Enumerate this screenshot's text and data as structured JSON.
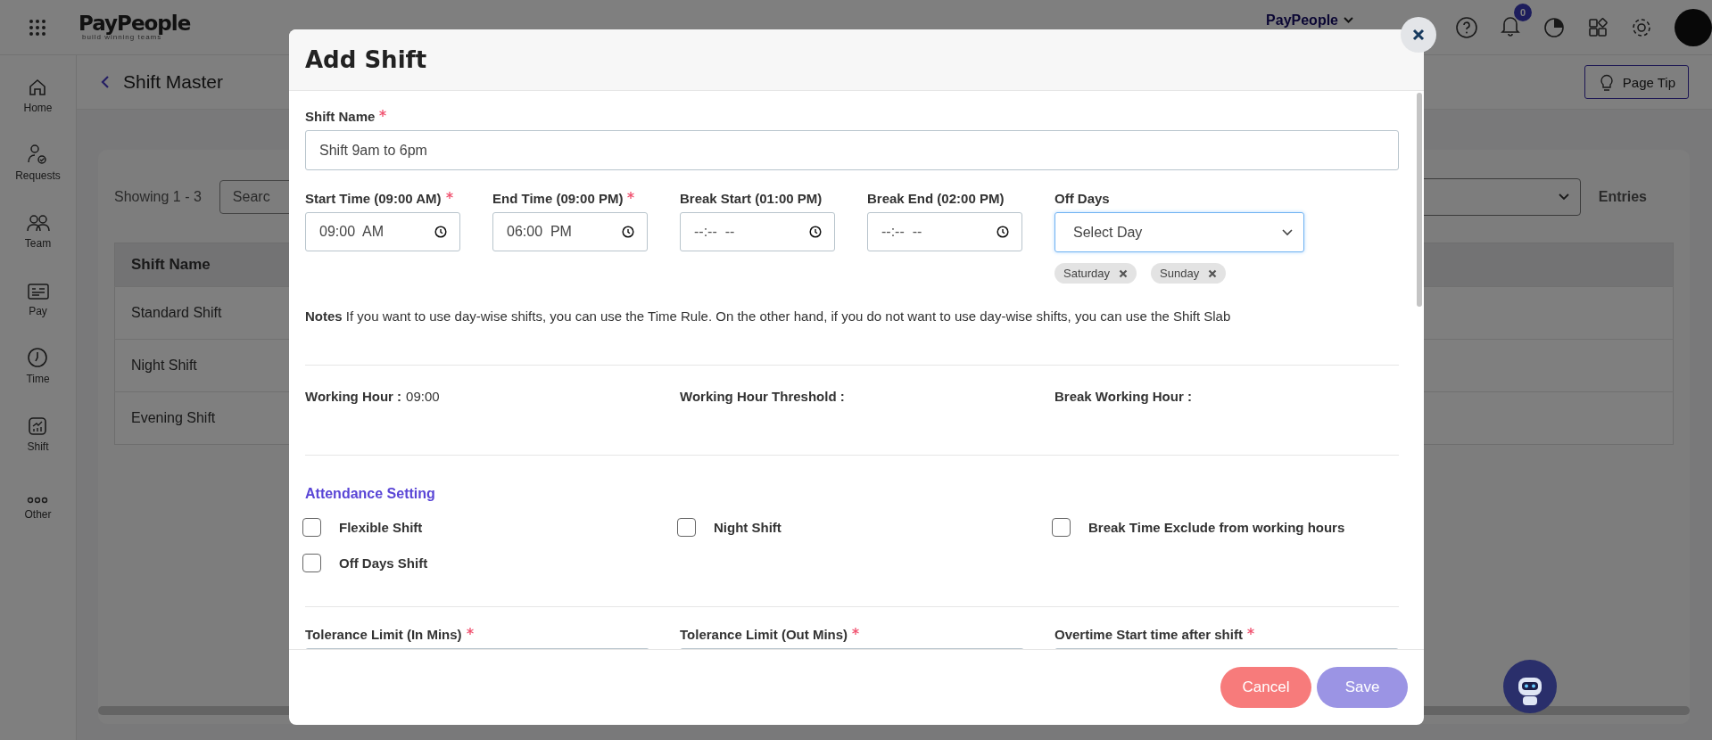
{
  "topbar": {
    "logo": "PayPeople",
    "tagline": "build winning teams",
    "company": "PayPeople",
    "notifications": "0"
  },
  "sidebar": {
    "items": [
      {
        "label": "Home"
      },
      {
        "label": "Requests"
      },
      {
        "label": "Team"
      },
      {
        "label": "Pay"
      },
      {
        "label": "Time"
      },
      {
        "label": "Shift"
      },
      {
        "label": "Other"
      }
    ]
  },
  "page": {
    "title": "Shift Master",
    "page_tip": "Page Tip",
    "showing": "Showing 1 - 3",
    "search_placeholder": "Searc",
    "entries_label": "Entries",
    "table": {
      "columns": [
        "Shift Name"
      ],
      "rows": [
        [
          "Standard Shift"
        ],
        [
          "Night Shift"
        ],
        [
          "Evening Shift"
        ]
      ]
    }
  },
  "modal": {
    "title": "Add Shift",
    "shift_name": {
      "label": "Shift Name",
      "required": true,
      "value": "Shift 9am to 6pm"
    },
    "time_fields": [
      {
        "label": "Start Time (09:00 AM)",
        "required": true,
        "value": "09:00  AM"
      },
      {
        "label": "End Time (09:00 PM)",
        "required": true,
        "value": "06:00  PM"
      },
      {
        "label": "Break Start (01:00 PM)",
        "required": false,
        "placeholder": "--:--  --"
      },
      {
        "label": "Break End (02:00 PM)",
        "required": false,
        "placeholder": "--:--  --"
      }
    ],
    "off_days": {
      "label": "Off Days",
      "placeholder": "Select Day",
      "chips": [
        "Saturday",
        "Sunday"
      ]
    },
    "notes": "**Notes** If you want to use day-wise shifts, you can use the Time Rule. On the other hand, if you do not want to use day-wise shifts, you can use the Shift Slab",
    "summary": [
      {
        "label": "Working Hour :",
        "value": "09:00"
      },
      {
        "label": "Working Hour Threshold :"
      },
      {
        "label": "Break Working Hour :"
      }
    ],
    "attendance_title": "Attendance Setting",
    "checkboxes": [
      {
        "label": "Flexible Shift",
        "checked": false
      },
      {
        "label": "Night Shift",
        "checked": false
      },
      {
        "label": "Break Time Exclude from working hours",
        "checked": false
      },
      {
        "label": "Off Days Shift",
        "checked": false
      }
    ],
    "limits": [
      {
        "label": "Tolerance Limit (In Mins)",
        "required": true
      },
      {
        "label": "Tolerance Limit (Out Mins)",
        "required": true
      },
      {
        "label": "Overtime Start time after shift",
        "required": true
      }
    ],
    "buttons": [
      {
        "label": "Cancel",
        "kind": "cancel"
      },
      {
        "label": "Save",
        "kind": "save"
      }
    ]
  }
}
